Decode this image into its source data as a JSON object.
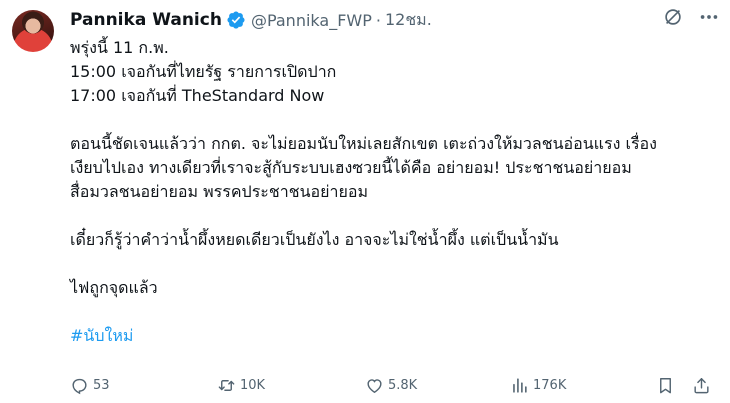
{
  "author": {
    "display_name": "Pannika Wanich",
    "handle": "@Pannika_FWP",
    "separator": "·",
    "time": "12ชม."
  },
  "colors": {
    "accent": "#1d9bf0",
    "muted": "#536471",
    "text": "#0f1419"
  },
  "tweet": {
    "lines": [
      "พรุ่งนี้ 11 ก.พ.",
      "15:00 เจอกันที่ไทยรัฐ รายการเปิดปาก",
      "17:00 เจอกันที่ TheStandard Now",
      "",
      "ตอนนี้ชัดเจนแล้วว่า กกต. จะไม่ยอมนับใหม่เลยสักเขต เตะถ่วงให้มวลชนอ่อนแรง เรื่อง",
      "เงียบไปเอง ทางเดียวที่เราจะสู้กับระบบเฮงซวยนี้ได้คือ อย่ายอม! ประชาชนอย่ายอม",
      "สื่อมวลชนอย่ายอม พรรคประชาชนอย่ายอม",
      "",
      "เดี๋ยวก็รู้ว่าคำว่าน้ำผึ้งหยดเดียวเป็นยังไง อาจจะไม่ใช่น้ำผึ้ง แต่เป็นน้ำมัน",
      "",
      "ไฟถูกจุดแล้ว",
      ""
    ],
    "hashtag": "#นับใหม่"
  },
  "actions": {
    "replies": "53",
    "retweets": "10K",
    "likes": "5.8K",
    "views": "176K"
  },
  "icons": [
    "verified-icon",
    "grok-icon",
    "more-icon",
    "reply-icon",
    "retweet-icon",
    "like-icon",
    "views-icon",
    "bookmark-icon",
    "share-icon"
  ]
}
